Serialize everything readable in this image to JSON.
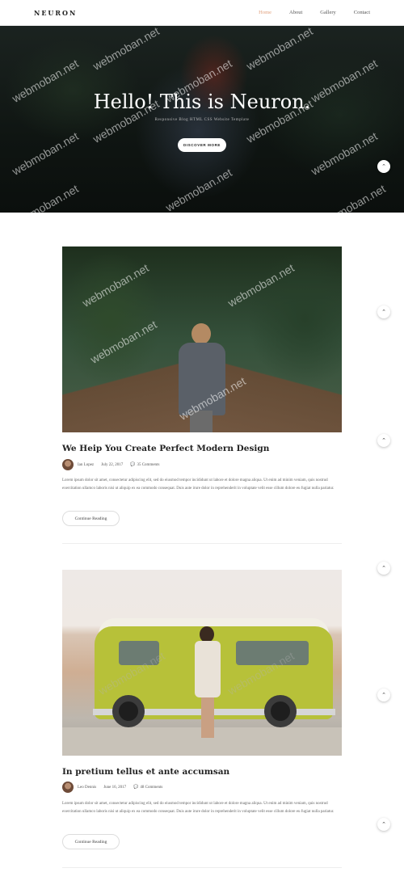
{
  "nav": {
    "logo": "NEURON",
    "items": [
      {
        "label": "Home",
        "active": true
      },
      {
        "label": "About",
        "active": false
      },
      {
        "label": "Gallery",
        "active": false
      },
      {
        "label": "Contact",
        "active": false
      }
    ]
  },
  "hero": {
    "title": "Hello! This is Neuron.",
    "subtitle": "Responsive Blog HTML CSS Website Template",
    "button_label": "DISCOVER MORE"
  },
  "scroll_buttons": [
    {
      "glyph": "⌃"
    },
    {
      "glyph": "⌃"
    },
    {
      "glyph": "⌃"
    },
    {
      "glyph": "⌃"
    },
    {
      "glyph": "⌃"
    },
    {
      "glyph": "⌃"
    },
    {
      "glyph": "⌃"
    }
  ],
  "posts": [
    {
      "title": "We Heip You Create Perfect Modern Design",
      "author": "Ian Lopez",
      "date": "July 22, 2017",
      "comments": "35 Comments",
      "excerpt": "Lorem ipsum dolor sit amet, consectetur adipiscing elit, sed do eiusmod tempor incididunt ut labore et dolore magna aliqua. Ut enim ad minim veniam, quis nostrud exercitation ullamco laboris nisi ut aliquip ex ea commodo consequat. Duis aute irure dolor in reprehenderit in voluptate velit esse cillum dolore eu fugiat nulla pariatur.",
      "button_label": "Continue Reading"
    },
    {
      "title": "In pretium tellus et ante accumsan",
      "author": "Leo Dennis",
      "date": "June 16, 2017",
      "comments": "48 Comments",
      "excerpt": "Lorem ipsum dolor sit amet, consectetur adipiscing elit, sed do eiusmod tempor incididunt ut labore et dolore magna aliqua. Ut enim ad minim veniam, quis nostrud exercitation ullamco laboris nisi ut aliquip ex ea commodo consequat. Duis aute irure dolor in reprehenderit in voluptate velit esse cillum dolore eu fugiat nulla pariatur.",
      "button_label": "Continue Reading"
    }
  ],
  "watermark": "webmoban.net",
  "colors": {
    "accent": "#e0a07d",
    "hero_bg": "#0f1512",
    "text": "#222222"
  }
}
